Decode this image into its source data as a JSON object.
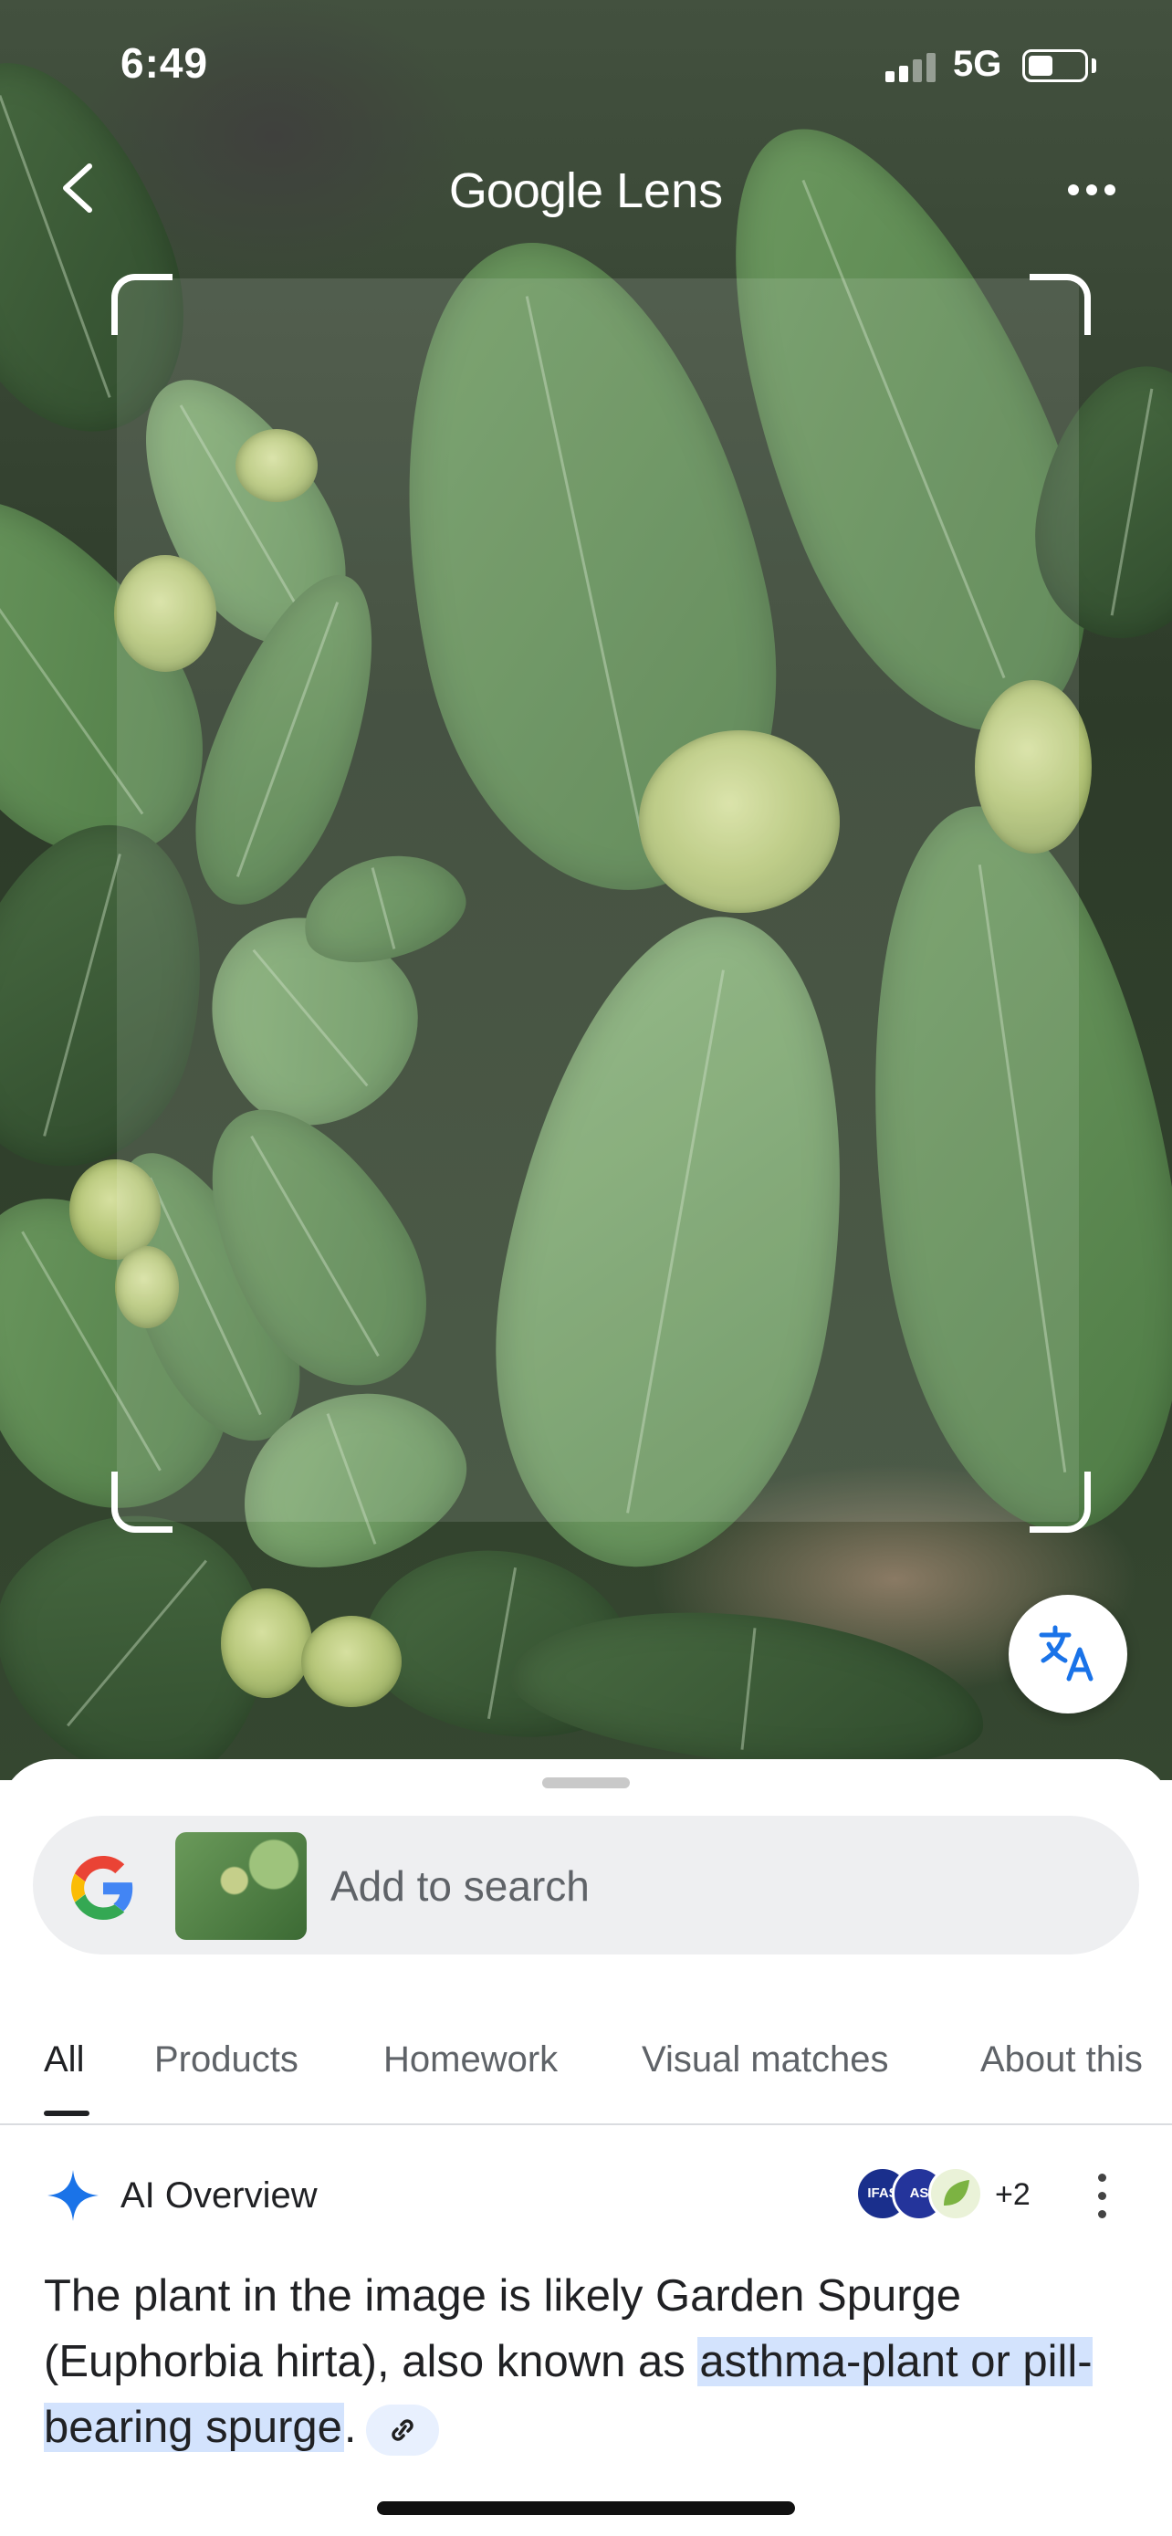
{
  "status_bar": {
    "time": "6:49",
    "network": "5G"
  },
  "header": {
    "title_google": "Google",
    "title_lens": "Lens"
  },
  "search": {
    "placeholder": "Add to search"
  },
  "tabs": [
    "All",
    "Products",
    "Homework",
    "Visual matches",
    "About this"
  ],
  "ai_overview": {
    "label": "AI Overview",
    "sources": [
      "IFAS",
      "AS"
    ],
    "extra_sources": "+2",
    "text_before": "The plant in the image is likely Garden Spurge (Euphorbia hirta), also known as ",
    "highlight": "asthma-plant or pill-bearing spurge",
    "text_after": "."
  },
  "colors": {
    "accent_blue": "#1a73e8",
    "highlight": "#d3e3fd"
  },
  "icons": [
    "back-arrow-icon",
    "more-icon",
    "translate-icon",
    "google-g-icon",
    "sparkle-icon",
    "link-icon"
  ]
}
